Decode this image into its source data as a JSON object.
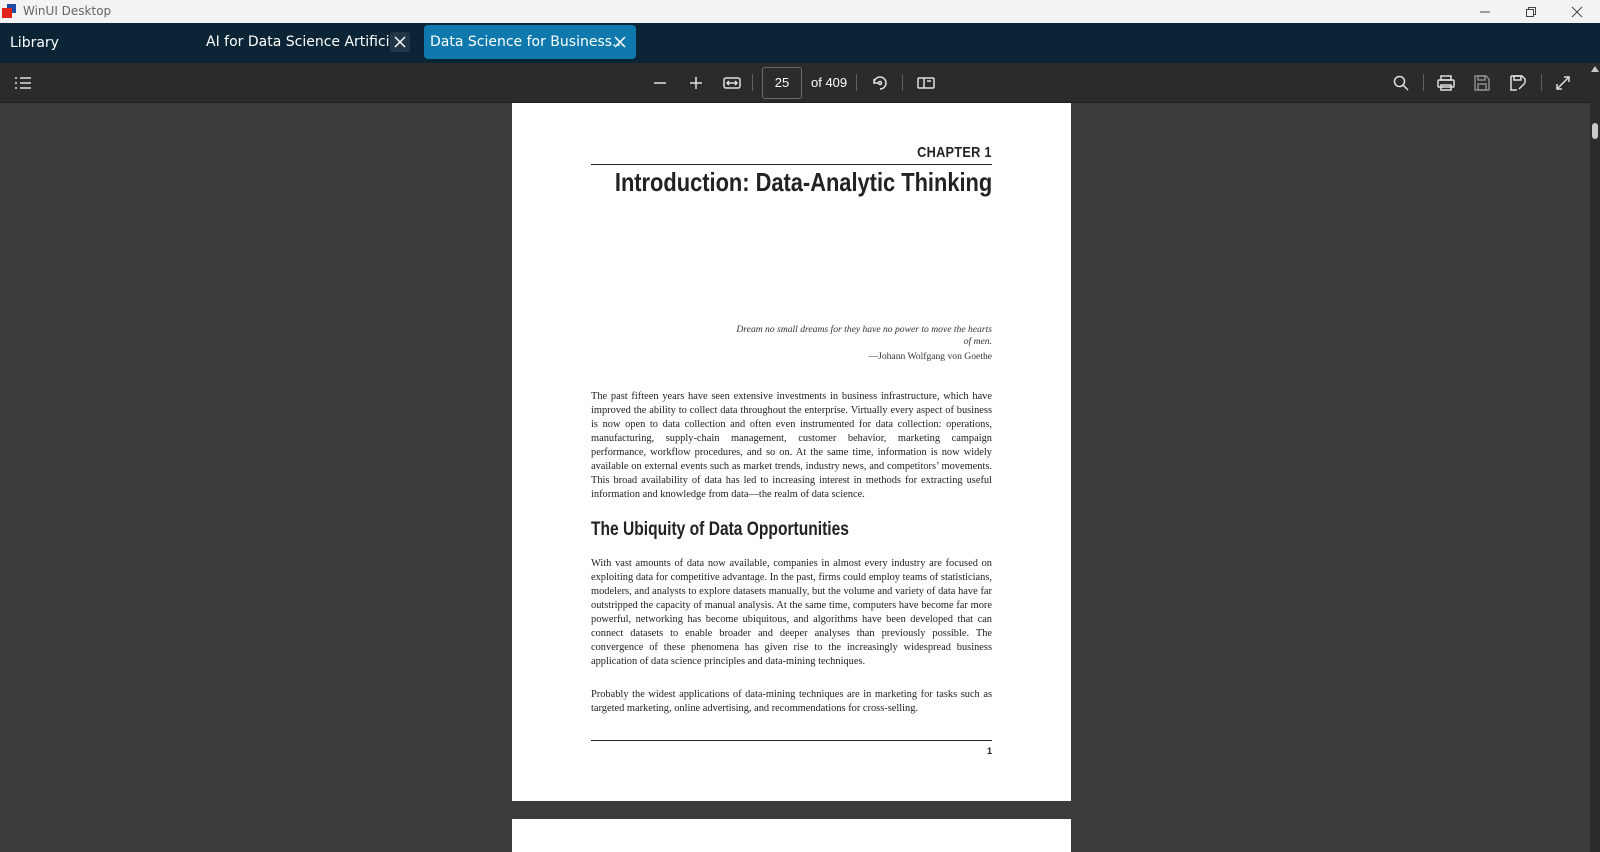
{
  "window": {
    "title": "WinUI Desktop"
  },
  "tabbar": {
    "library_label": "Library",
    "tabs": [
      {
        "label": "AI for Data Science Artificia...",
        "active": false
      },
      {
        "label": "Data Science for Business...",
        "active": true
      }
    ]
  },
  "toolbar": {
    "page_current": "25",
    "page_total": "of 409",
    "icons": [
      "toc-list-icon",
      "zoom-out-icon",
      "zoom-in-icon",
      "fit-width-icon",
      "rotate-icon",
      "page-layout-icon",
      "search-icon",
      "print-icon",
      "save-icon",
      "save-as-icon",
      "fullscreen-icon"
    ]
  },
  "document": {
    "chapter_label": "CHAPTER 1",
    "chapter_title": "Introduction: Data-Analytic Thinking",
    "epigraph": "Dream no small dreams for they have no power to move the hearts of men.",
    "epigraph_attribution": "—Johann Wolfgang von Goethe",
    "para1": "The past fifteen years have seen extensive investments in business infrastructure, which have improved the ability to collect data throughout the enterprise. Virtually every aspect of business is now open to data collection and often even instrumented for data collection: operations, manufacturing, supply-chain management, customer behavior, marketing campaign performance, workflow procedures, and so on. At the same time, information is now widely available on external events such as market trends, industry news, and competitors’ movements. This broad availability of data has led to increasing interest in methods for extracting useful information and knowledge from data—the realm of data science.",
    "section_heading": "The Ubiquity of Data Opportunities",
    "para2": "With vast amounts of data now available, companies in almost every industry are focused on exploiting data for competitive advantage. In the past, firms could employ teams of statisticians, modelers, and analysts to explore datasets manually, but the volume and variety of data have far outstripped the capacity of manual analysis. At the same time, computers have become far more powerful, networking has become ubiquitous, and algorithms have been developed that can connect datasets to enable broader and deeper analyses than previously possible. The convergence of these phenomena has given rise to the increasingly widespread business application of data science principles and data-mining techniques.",
    "para3": "Probably the widest applications of data-mining techniques are in marketing for tasks such as targeted marketing, online advertising, and recommendations for cross-selling.",
    "page_number": "1"
  },
  "colors": {
    "tabbar_bg": "#0c2536",
    "active_tab": "#0f79ad",
    "toolbar_bg": "#2b2b2b",
    "viewer_bg": "#3b3b3b"
  }
}
